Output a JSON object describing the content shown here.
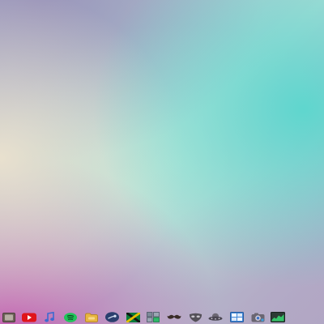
{
  "desktop": {
    "colors": {
      "teal": "#5AD6CE",
      "cream": "#ECE2CE",
      "magenta": "#C45CB0",
      "lavender": "#9A92B8"
    }
  },
  "dock": {
    "items": [
      {
        "icon": "file-manager-icon"
      },
      {
        "icon": "youtube-icon"
      },
      {
        "icon": "music-note-icon"
      },
      {
        "icon": "spotify-icon"
      },
      {
        "icon": "folder-icon"
      },
      {
        "icon": "steam-icon"
      },
      {
        "icon": "flag-icon"
      },
      {
        "icon": "control-panel-icon"
      },
      {
        "icon": "mustache-icon"
      },
      {
        "icon": "mask-icon"
      },
      {
        "icon": "ufo-icon"
      },
      {
        "icon": "window-manager-icon"
      },
      {
        "icon": "camera-icon"
      },
      {
        "icon": "system-monitor-icon"
      }
    ]
  }
}
